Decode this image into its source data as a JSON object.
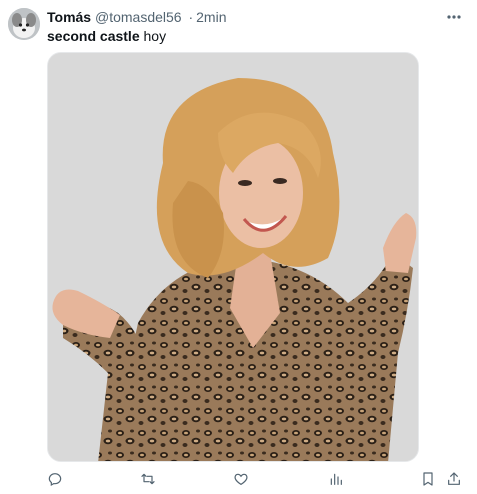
{
  "tweet": {
    "author_name": "Tomás",
    "handle": "@tomasdel56",
    "separator": "·",
    "time": "2min",
    "text_bold": "second castle",
    "text_rest": " hoy",
    "avatar_icon": "dog-avatar",
    "more_icon": "more-dots-icon",
    "media": {
      "description_icon": "photo",
      "background_color": "#d8d8d8"
    }
  },
  "actions": [
    {
      "name": "reply",
      "icon": "reply-icon"
    },
    {
      "name": "retweet",
      "icon": "retweet-icon"
    },
    {
      "name": "like",
      "icon": "heart-icon"
    },
    {
      "name": "views",
      "icon": "views-icon"
    },
    {
      "name": "bookmark",
      "icon": "bookmark-icon"
    },
    {
      "name": "share",
      "icon": "share-icon"
    }
  ],
  "colors": {
    "text": "#0f1419",
    "secondary": "#536471"
  }
}
